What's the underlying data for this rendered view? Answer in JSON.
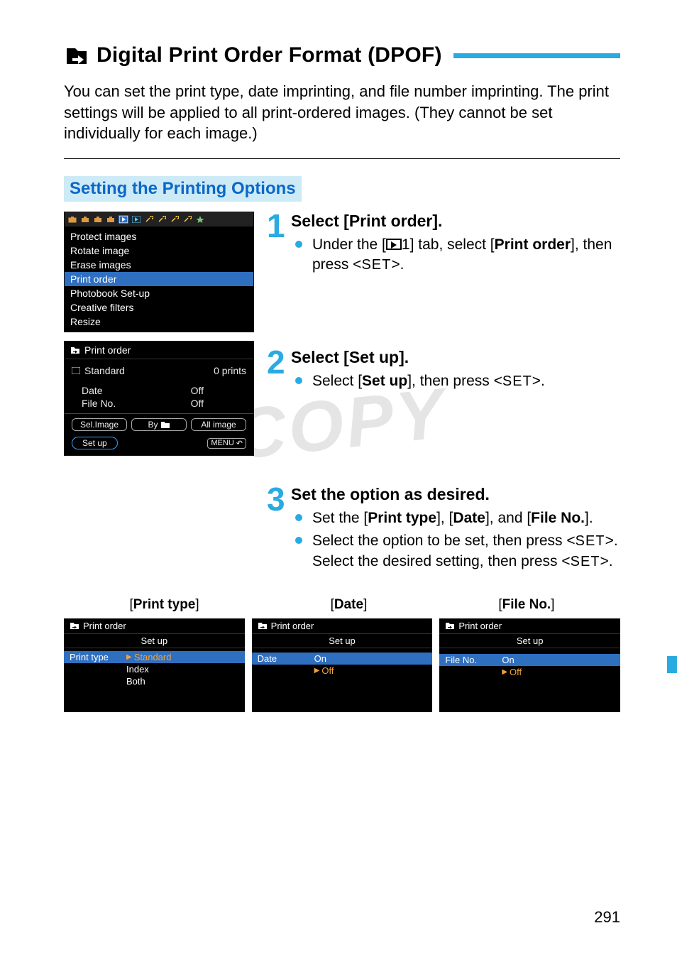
{
  "title": "Digital Print Order Format (DPOF)",
  "intro": "You can set the print type, date imprinting, and file number imprinting. The print settings will be applied to all print-ordered images. (They cannot be set individually for each image.)",
  "section_heading": "Setting the Printing Options",
  "watermark": "COPY",
  "page_number": "291",
  "menu_screen": {
    "items": [
      "Protect images",
      "Rotate image",
      "Erase images",
      "Print order",
      "Photobook Set-up",
      "Creative filters",
      "Resize"
    ],
    "selected_index": 3
  },
  "print_order_screen": {
    "title": "Print order",
    "type_row": {
      "label": "Standard",
      "value": "0 prints"
    },
    "rows": [
      {
        "label": "Date",
        "value": "Off"
      },
      {
        "label": "File No.",
        "value": "Off"
      }
    ],
    "buttons": [
      "Sel.Image",
      "By",
      "All image"
    ],
    "setup_btn": "Set up",
    "menu_label": "MENU"
  },
  "steps": {
    "s1": {
      "num": "1",
      "heading": "Select [Print order].",
      "bullet_pre": "Under the [",
      "bullet_mid": "1] tab, select [",
      "bullet_bold": "Print order",
      "bullet_post": "], then press <",
      "bullet_set": "SET",
      "bullet_end": ">."
    },
    "s2": {
      "num": "2",
      "heading": "Select [Set up].",
      "bullet_pre": "Select [",
      "bullet_bold": "Set up",
      "bullet_post": "], then press <",
      "bullet_set": "SET",
      "bullet_end": ">."
    },
    "s3": {
      "num": "3",
      "heading": "Set the option as desired.",
      "b1_pre": "Set the [",
      "b1_a": "Print type",
      "b1_mid1": "], [",
      "b1_b": "Date",
      "b1_mid2": "], and [",
      "b1_c": "File No.",
      "b1_end": "].",
      "b2_pre": "Select the option to be set, then press <",
      "b2_set1": "SET",
      "b2_mid": ">. Select the desired setting, then press <",
      "b2_set2": "SET",
      "b2_end": ">."
    }
  },
  "option_labels": {
    "a": "Print type",
    "b": "Date",
    "c": "File No."
  },
  "mini": {
    "title": "Print order",
    "sub": "Set up",
    "print_type": {
      "label": "Print type",
      "opts": [
        "Standard",
        "Index",
        "Both"
      ],
      "selected_index": 0
    },
    "date": {
      "label": "Date",
      "opts": [
        "On",
        "Off"
      ],
      "selected_index": 1
    },
    "file_no": {
      "label": "File No.",
      "opts": [
        "On",
        "Off"
      ],
      "selected_index": 1
    }
  }
}
